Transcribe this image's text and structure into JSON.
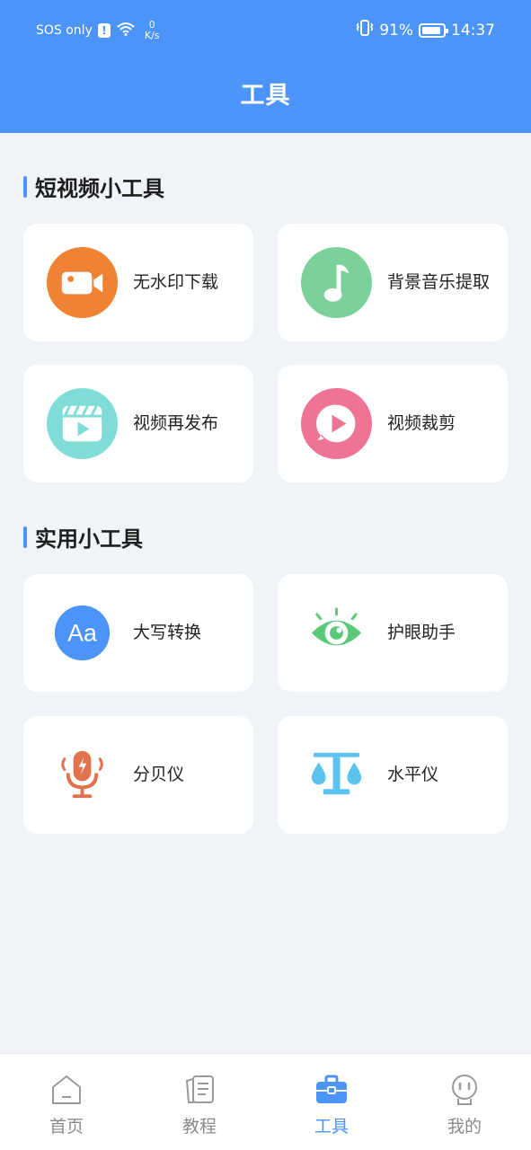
{
  "status_bar": {
    "carrier": "SOS only",
    "net_speed_value": "0",
    "net_speed_unit": "K/s",
    "battery": "91%",
    "time": "14:37"
  },
  "header": {
    "title": "工具"
  },
  "sections": [
    {
      "title": "短视频小工具",
      "tools": [
        {
          "label": "无水印下载",
          "icon": "video-camera-icon",
          "color": "#f08234"
        },
        {
          "label": "背景音乐提取",
          "icon": "music-note-icon",
          "color": "#7bd19a"
        },
        {
          "label": "视频再发布",
          "icon": "clapperboard-icon",
          "color": "#7fdcd6"
        },
        {
          "label": "视频裁剪",
          "icon": "play-bubble-icon",
          "color": "#ee7394"
        }
      ]
    },
    {
      "title": "实用小工具",
      "tools": [
        {
          "label": "大写转换",
          "icon": "text-case-icon",
          "icon_text": "Aa",
          "color": "#4c94f7"
        },
        {
          "label": "护眼助手",
          "icon": "eye-icon",
          "color": "#5cc97a"
        },
        {
          "label": "分贝仪",
          "icon": "microphone-icon",
          "color": "#e2714d"
        },
        {
          "label": "水平仪",
          "icon": "level-icon",
          "color": "#5bc3ee"
        }
      ]
    }
  ],
  "tabbar": {
    "items": [
      {
        "label": "首页",
        "icon": "home-icon",
        "active": false
      },
      {
        "label": "教程",
        "icon": "document-icon",
        "active": false
      },
      {
        "label": "工具",
        "icon": "toolbox-icon",
        "active": true
      },
      {
        "label": "我的",
        "icon": "profile-icon",
        "active": false
      }
    ]
  },
  "colors": {
    "primary": "#4c94f7",
    "background": "#f0f4f8",
    "card": "#ffffff",
    "inactive_tab": "#8a8a8a"
  }
}
